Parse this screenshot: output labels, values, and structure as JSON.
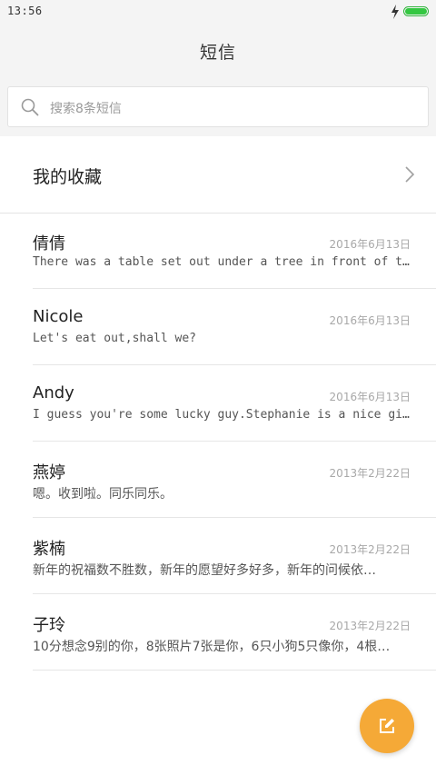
{
  "status_bar": {
    "time": "13:56"
  },
  "header": {
    "title": "短信"
  },
  "search": {
    "placeholder": "搜索8条短信"
  },
  "favorites": {
    "label": "我的收藏"
  },
  "messages": [
    {
      "name": "倩倩",
      "date": "2016年6月13日",
      "preview": "There was a table set out under a tree in front of th…"
    },
    {
      "name": "Nicole",
      "date": "2016年6月13日",
      "preview": "Let's eat out,shall we?"
    },
    {
      "name": "Andy",
      "date": "2016年6月13日",
      "preview": "I guess you're some lucky guy.Stephanie is a nice girl."
    },
    {
      "name": "燕婷",
      "date": "2013年2月22日",
      "preview": "嗯。收到啦。同乐同乐。"
    },
    {
      "name": "紫楠",
      "date": "2013年2月22日",
      "preview": "新年的祝福数不胜数，新年的愿望好多好多，新年的问候依…"
    },
    {
      "name": "子玲",
      "date": "2013年2月22日",
      "preview": "10分想念9别的你，8张照片7张是你，6只小狗5只像你，4根…"
    }
  ],
  "icons": {
    "charging": "charging-icon",
    "battery": "battery-icon",
    "search": "search-icon",
    "chevron": "chevron-right-icon",
    "compose": "compose-icon"
  },
  "colors": {
    "accent": "#f5a937",
    "battery": "#34c741",
    "header_bg": "#f4f4f4"
  }
}
